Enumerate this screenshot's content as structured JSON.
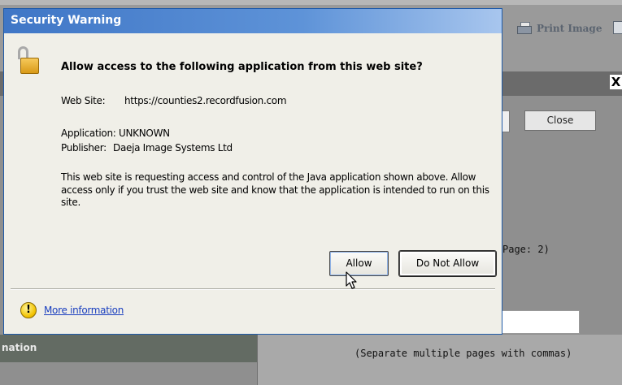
{
  "background_app": {
    "print_label": "Print Image",
    "close_x": "X",
    "close_button": "Close",
    "page_text": "Page: 2)",
    "left_header": "nation",
    "hint": "(Separate multiple pages with commas)"
  },
  "dialog": {
    "title": "Security Warning",
    "heading": "Allow access to the following application from this web site?",
    "website_label": "Web Site:",
    "website_value": "https://counties2.recordfusion.com",
    "application_label": "Application:",
    "application_value": "UNKNOWN",
    "publisher_label": "Publisher:",
    "publisher_value": "Daeja Image Systems Ltd",
    "description": "This web site is requesting access and control of the Java application shown above. Allow access only if you trust the web site and know that the application is intended to run on this site.",
    "allow_label": "Allow",
    "deny_label": "Do Not Allow",
    "more_info_label": "More information",
    "warning_glyph": "!"
  },
  "icons": [
    "lock-icon",
    "warning-icon",
    "printer-icon",
    "mouse-cursor-icon"
  ],
  "colors": {
    "titlebar": "#3f76c6",
    "link": "#1a3fbf",
    "lock": "#e0a82a"
  }
}
